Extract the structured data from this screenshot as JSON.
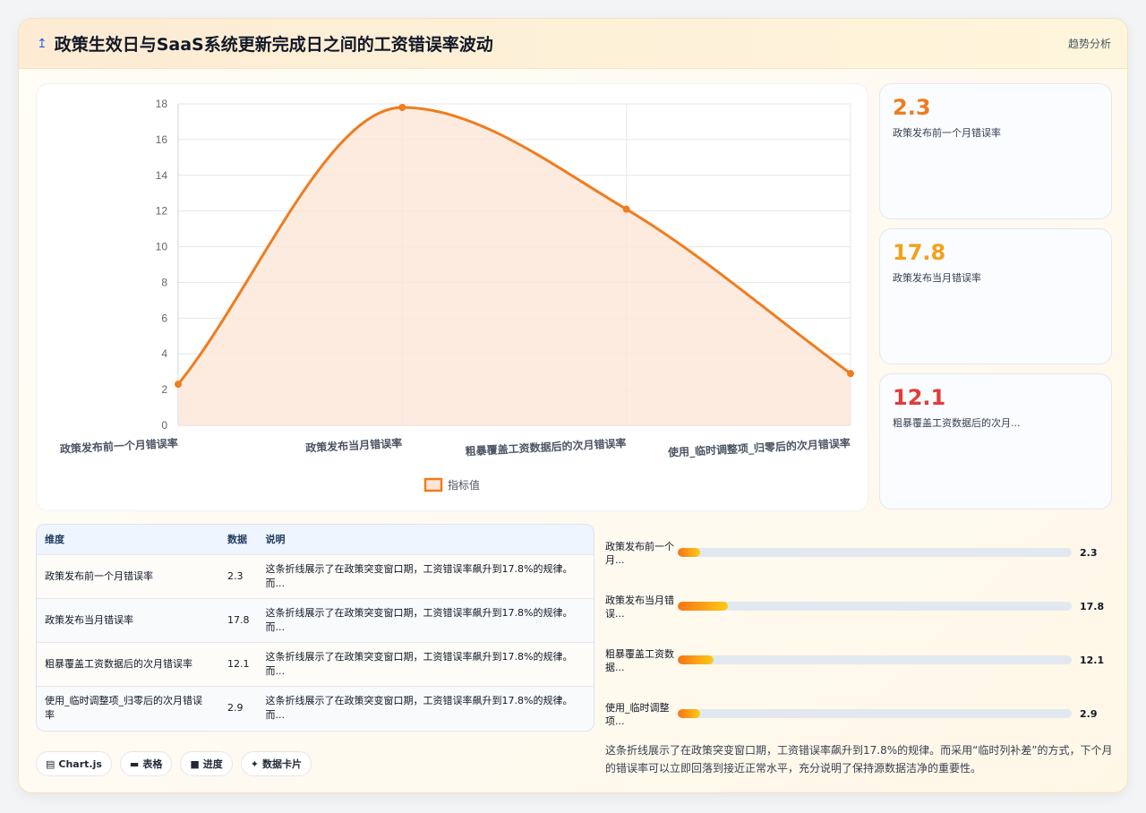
{
  "header": {
    "icon": "chart-icon",
    "title": "政策生效日与SaaS系统更新完成日之间的工资错误率波动",
    "right_label": "趋势分析"
  },
  "chart_data": {
    "type": "line",
    "categories": [
      "政策发布前一个月错误率",
      "政策发布当月错误率",
      "粗暴覆盖工资数据后的次月错误率",
      "使用_临时调整项_归零后的次月错误率"
    ],
    "series": [
      {
        "name": "指标值",
        "values": [
          2.3,
          17.8,
          12.1,
          2.9
        ]
      }
    ],
    "y_ticks": [
      "0",
      "2",
      "4",
      "6",
      "8",
      "10",
      "12",
      "14",
      "16",
      "18"
    ],
    "ylim": [
      0,
      18
    ],
    "grid": true,
    "legend": "bottom",
    "color": "#f07c1e",
    "fill": "#fde6d8"
  },
  "stats": [
    {
      "value": "2.3",
      "label": "政策发布前一个月错误率",
      "color": "#f07c1e"
    },
    {
      "value": "17.8",
      "label": "政策发布当月错误率",
      "color": "#f5a01a"
    },
    {
      "value": "12.1",
      "label": "粗暴覆盖工资数据后的次月...",
      "color": "#e23b3b"
    }
  ],
  "table": {
    "headers": [
      "维度",
      "数据",
      "说明"
    ],
    "rows": [
      {
        "name": "政策发布前一个月错误率",
        "value": "2.3",
        "desc": "这条折线展示了在政策突变窗口期，工资错误率飙升到17.8%的规律。而..."
      },
      {
        "name": "政策发布当月错误率",
        "value": "17.8",
        "desc": "这条折线展示了在政策突变窗口期，工资错误率飙升到17.8%的规律。而..."
      },
      {
        "name": "粗暴覆盖工资数据后的次月错误率",
        "value": "12.1",
        "desc": "这条折线展示了在政策突变窗口期，工资错误率飙升到17.8%的规律。而..."
      },
      {
        "name": "使用_临时调整项_归零后的次月错误率",
        "value": "2.9",
        "desc": "这条折线展示了在政策突变窗口期，工资错误率飙升到17.8%的规律。而..."
      }
    ]
  },
  "progress": [
    {
      "label": "政策发布前一个月...",
      "value": "2.3",
      "fraction": 0.057
    },
    {
      "label": "政策发布当月错误...",
      "value": "17.8",
      "fraction": 0.127
    },
    {
      "label": "粗暴覆盖工资数据...",
      "value": "12.1",
      "fraction": 0.09
    },
    {
      "label": "使用_临时调整项...",
      "value": "2.9",
      "fraction": 0.057
    }
  ],
  "summary": "这条折线展示了在政策突变窗口期，工资错误率飙升到17.8%的规律。而采用“临时列补差”的方式，下个月的错误率可以立即回落到接近正常水平，充分说明了保持源数据洁净的重要性。",
  "tags": [
    {
      "icon": "chart-icon",
      "label": "Chart.js"
    },
    {
      "icon": "table-icon",
      "label": "表格"
    },
    {
      "icon": "folder-icon",
      "label": "进度"
    },
    {
      "icon": "sparkle-icon",
      "label": "数据卡片"
    }
  ]
}
